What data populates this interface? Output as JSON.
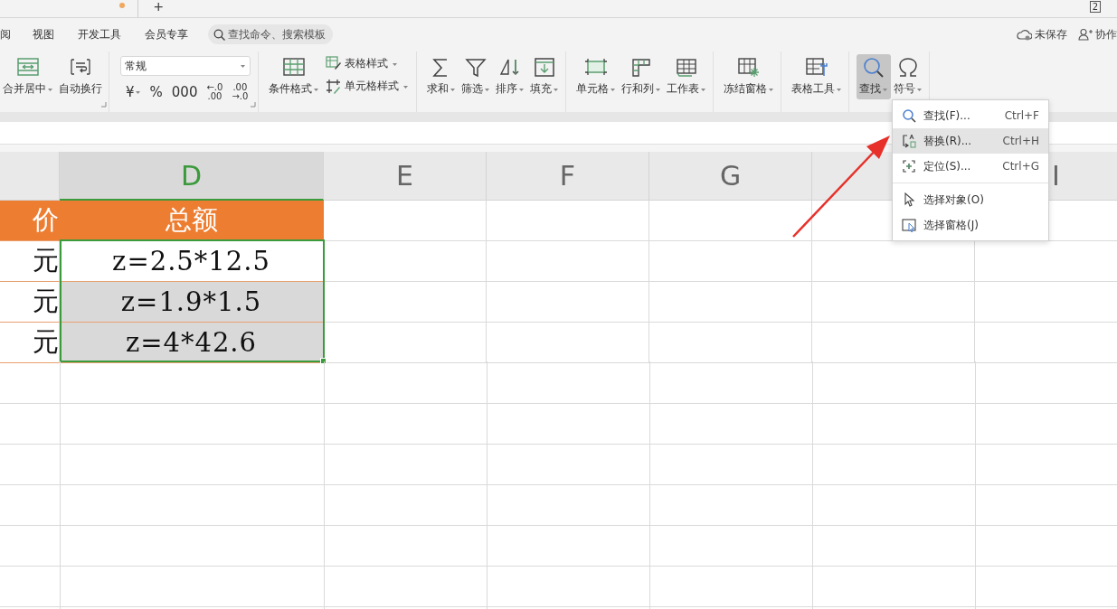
{
  "tab_strip": {
    "modified": true,
    "new_tab": "+",
    "window_count": "2"
  },
  "menu_tabs": [
    {
      "label": "阅",
      "selected": false
    },
    {
      "label": "视图",
      "selected": false
    },
    {
      "label": "开发工具",
      "selected": false
    },
    {
      "label": "会员专享",
      "selected": false
    }
  ],
  "search": {
    "placeholder": "查找命令、搜索模板"
  },
  "status": [
    {
      "label": "未保存"
    },
    {
      "label": "协作"
    }
  ],
  "ribbon": [
    {
      "launcher": true,
      "items": [
        {
          "kind": "large",
          "label": "合并居中",
          "dropdown": true,
          "active": false
        },
        {
          "kind": "large",
          "label": "自动换行",
          "dropdown": false,
          "active": false
        }
      ]
    },
    {
      "launcher": true,
      "items": [
        {
          "kind": "stack",
          "items": [
            {
              "kind": "select",
              "value": "常规"
            },
            {
              "kind": "glyphs",
              "items": [
                {
                  "lines": [
                    "¥"
                  ],
                  "dropdown": true
                },
                {
                  "lines": [
                    "%"
                  ],
                  "dropdown": false
                },
                {
                  "lines": [
                    "000"
                  ],
                  "dropdown": false
                },
                {
                  "lines": [
                    "←.0",
                    ".00"
                  ],
                  "dropdown": false
                },
                {
                  "lines": [
                    ".00",
                    "→.0"
                  ],
                  "dropdown": false
                }
              ]
            }
          ]
        }
      ]
    },
    {
      "items": [
        {
          "kind": "large",
          "label": "条件格式",
          "dropdown": true,
          "active": false
        },
        {
          "kind": "stack",
          "items": [
            {
              "kind": "small",
              "label": "表格样式",
              "dropdown": true
            },
            {
              "kind": "small",
              "label": "单元格样式",
              "dropdown": true
            }
          ]
        }
      ]
    },
    {
      "items": [
        {
          "kind": "large",
          "label": "求和",
          "dropdown": true,
          "active": false
        },
        {
          "kind": "large",
          "label": "筛选",
          "dropdown": true,
          "active": false
        },
        {
          "kind": "large",
          "label": "排序",
          "dropdown": true,
          "active": false
        },
        {
          "kind": "large",
          "label": "填充",
          "dropdown": true,
          "active": false
        }
      ]
    },
    {
      "items": [
        {
          "kind": "large",
          "label": "单元格",
          "dropdown": true,
          "active": false
        },
        {
          "kind": "large",
          "label": "行和列",
          "dropdown": true,
          "active": false
        },
        {
          "kind": "large",
          "label": "工作表",
          "dropdown": true,
          "active": false
        }
      ]
    },
    {
      "items": [
        {
          "kind": "large",
          "label": "冻结窗格",
          "dropdown": true,
          "active": false
        }
      ]
    },
    {
      "items": [
        {
          "kind": "large",
          "label": "表格工具",
          "dropdown": true,
          "active": false
        }
      ]
    },
    {
      "items": [
        {
          "kind": "large",
          "label": "查找",
          "dropdown": true,
          "active": true
        },
        {
          "kind": "large",
          "label": "符号",
          "dropdown": true,
          "active": false
        }
      ]
    }
  ],
  "find_menu": [
    {
      "label": "查找(F)...",
      "shortcut": "Ctrl+F",
      "selected": false
    },
    {
      "label": "替换(R)...",
      "shortcut": "Ctrl+H",
      "selected": true
    },
    {
      "label": "定位(S)...",
      "shortcut": "Ctrl+G",
      "selected": false
    },
    {
      "label": "选择对象(O)",
      "separator_before": true,
      "selected": false
    },
    {
      "label": "选择窗格(J)",
      "selected": false
    }
  ],
  "grid": {
    "columns": [
      {
        "selected": false
      },
      {
        "label": "D",
        "selected": true
      },
      {
        "label": "E",
        "selected": false
      },
      {
        "label": "F",
        "selected": false
      },
      {
        "label": "G",
        "selected": false
      },
      {
        "selected": false
      },
      {
        "label": "I",
        "selected": false
      }
    ],
    "rows": [
      {
        "kind": "header",
        "cells": [
          {
            "text": "价",
            "selected": false
          },
          {
            "text": "总额",
            "selected": false
          }
        ]
      },
      {
        "kind": "data",
        "cells": [
          {
            "text": "元",
            "selected": false
          },
          {
            "text": "z=2.5*12.5",
            "selected": true,
            "active": true
          }
        ]
      },
      {
        "kind": "data",
        "cells": [
          {
            "text": "元",
            "selected": false
          },
          {
            "text": "z=1.9*1.5",
            "selected": true,
            "active": false
          }
        ]
      },
      {
        "kind": "data",
        "cells": [
          {
            "text": "元",
            "selected": false
          },
          {
            "text": "z=4*42.6",
            "selected": true,
            "active": false
          }
        ]
      }
    ]
  }
}
